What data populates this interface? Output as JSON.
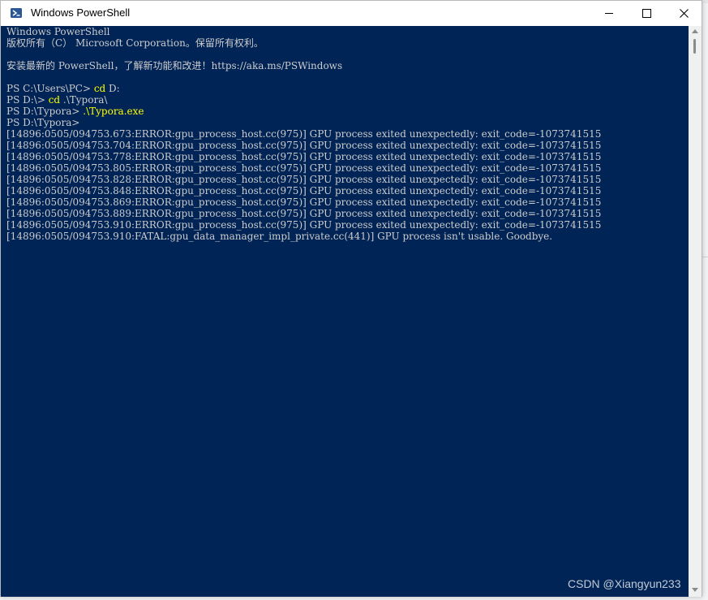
{
  "window": {
    "title": "Windows PowerShell"
  },
  "console": {
    "lines": [
      {
        "segments": [
          {
            "text": "Windows PowerShell"
          }
        ]
      },
      {
        "segments": [
          {
            "text": "版权所有（C） Microsoft Corporation。保留所有权利。"
          }
        ]
      },
      {
        "segments": [
          {
            "text": ""
          }
        ]
      },
      {
        "segments": [
          {
            "text": "安装最新的 PowerShell，了解新功能和改进！https://aka.ms/PSWindows"
          }
        ]
      },
      {
        "segments": [
          {
            "text": ""
          }
        ]
      },
      {
        "segments": [
          {
            "text": "PS C:\\Users\\PC> "
          },
          {
            "text": "cd",
            "cmd": true
          },
          {
            "text": " D:"
          }
        ]
      },
      {
        "segments": [
          {
            "text": "PS D:\\> "
          },
          {
            "text": "cd",
            "cmd": true
          },
          {
            "text": " .\\Typora\\"
          }
        ]
      },
      {
        "segments": [
          {
            "text": "PS D:\\Typora> "
          },
          {
            "text": ".\\Typora.exe",
            "cmd": true
          }
        ]
      },
      {
        "segments": [
          {
            "text": "PS D:\\Typora>"
          }
        ]
      },
      {
        "segments": [
          {
            "text": "[14896:0505/094753.673:ERROR:gpu_process_host.cc(975)] GPU process exited unexpectedly: exit_code=-1073741515"
          }
        ]
      },
      {
        "segments": [
          {
            "text": "[14896:0505/094753.704:ERROR:gpu_process_host.cc(975)] GPU process exited unexpectedly: exit_code=-1073741515"
          }
        ]
      },
      {
        "segments": [
          {
            "text": "[14896:0505/094753.778:ERROR:gpu_process_host.cc(975)] GPU process exited unexpectedly: exit_code=-1073741515"
          }
        ]
      },
      {
        "segments": [
          {
            "text": "[14896:0505/094753.805:ERROR:gpu_process_host.cc(975)] GPU process exited unexpectedly: exit_code=-1073741515"
          }
        ]
      },
      {
        "segments": [
          {
            "text": "[14896:0505/094753.828:ERROR:gpu_process_host.cc(975)] GPU process exited unexpectedly: exit_code=-1073741515"
          }
        ]
      },
      {
        "segments": [
          {
            "text": "[14896:0505/094753.848:ERROR:gpu_process_host.cc(975)] GPU process exited unexpectedly: exit_code=-1073741515"
          }
        ]
      },
      {
        "segments": [
          {
            "text": "[14896:0505/094753.869:ERROR:gpu_process_host.cc(975)] GPU process exited unexpectedly: exit_code=-1073741515"
          }
        ]
      },
      {
        "segments": [
          {
            "text": "[14896:0505/094753.889:ERROR:gpu_process_host.cc(975)] GPU process exited unexpectedly: exit_code=-1073741515"
          }
        ]
      },
      {
        "segments": [
          {
            "text": "[14896:0505/094753.910:ERROR:gpu_process_host.cc(975)] GPU process exited unexpectedly: exit_code=-1073741515"
          }
        ]
      },
      {
        "segments": [
          {
            "text": "[14896:0505/094753.910:FATAL:gpu_data_manager_impl_private.cc(441)] GPU process isn't usable. Goodbye."
          }
        ]
      }
    ]
  },
  "watermark": "CSDN @Xiangyun233",
  "colors": {
    "console_bg": "#012456",
    "console_text": "#cccccc",
    "command_text": "#ffff00"
  }
}
